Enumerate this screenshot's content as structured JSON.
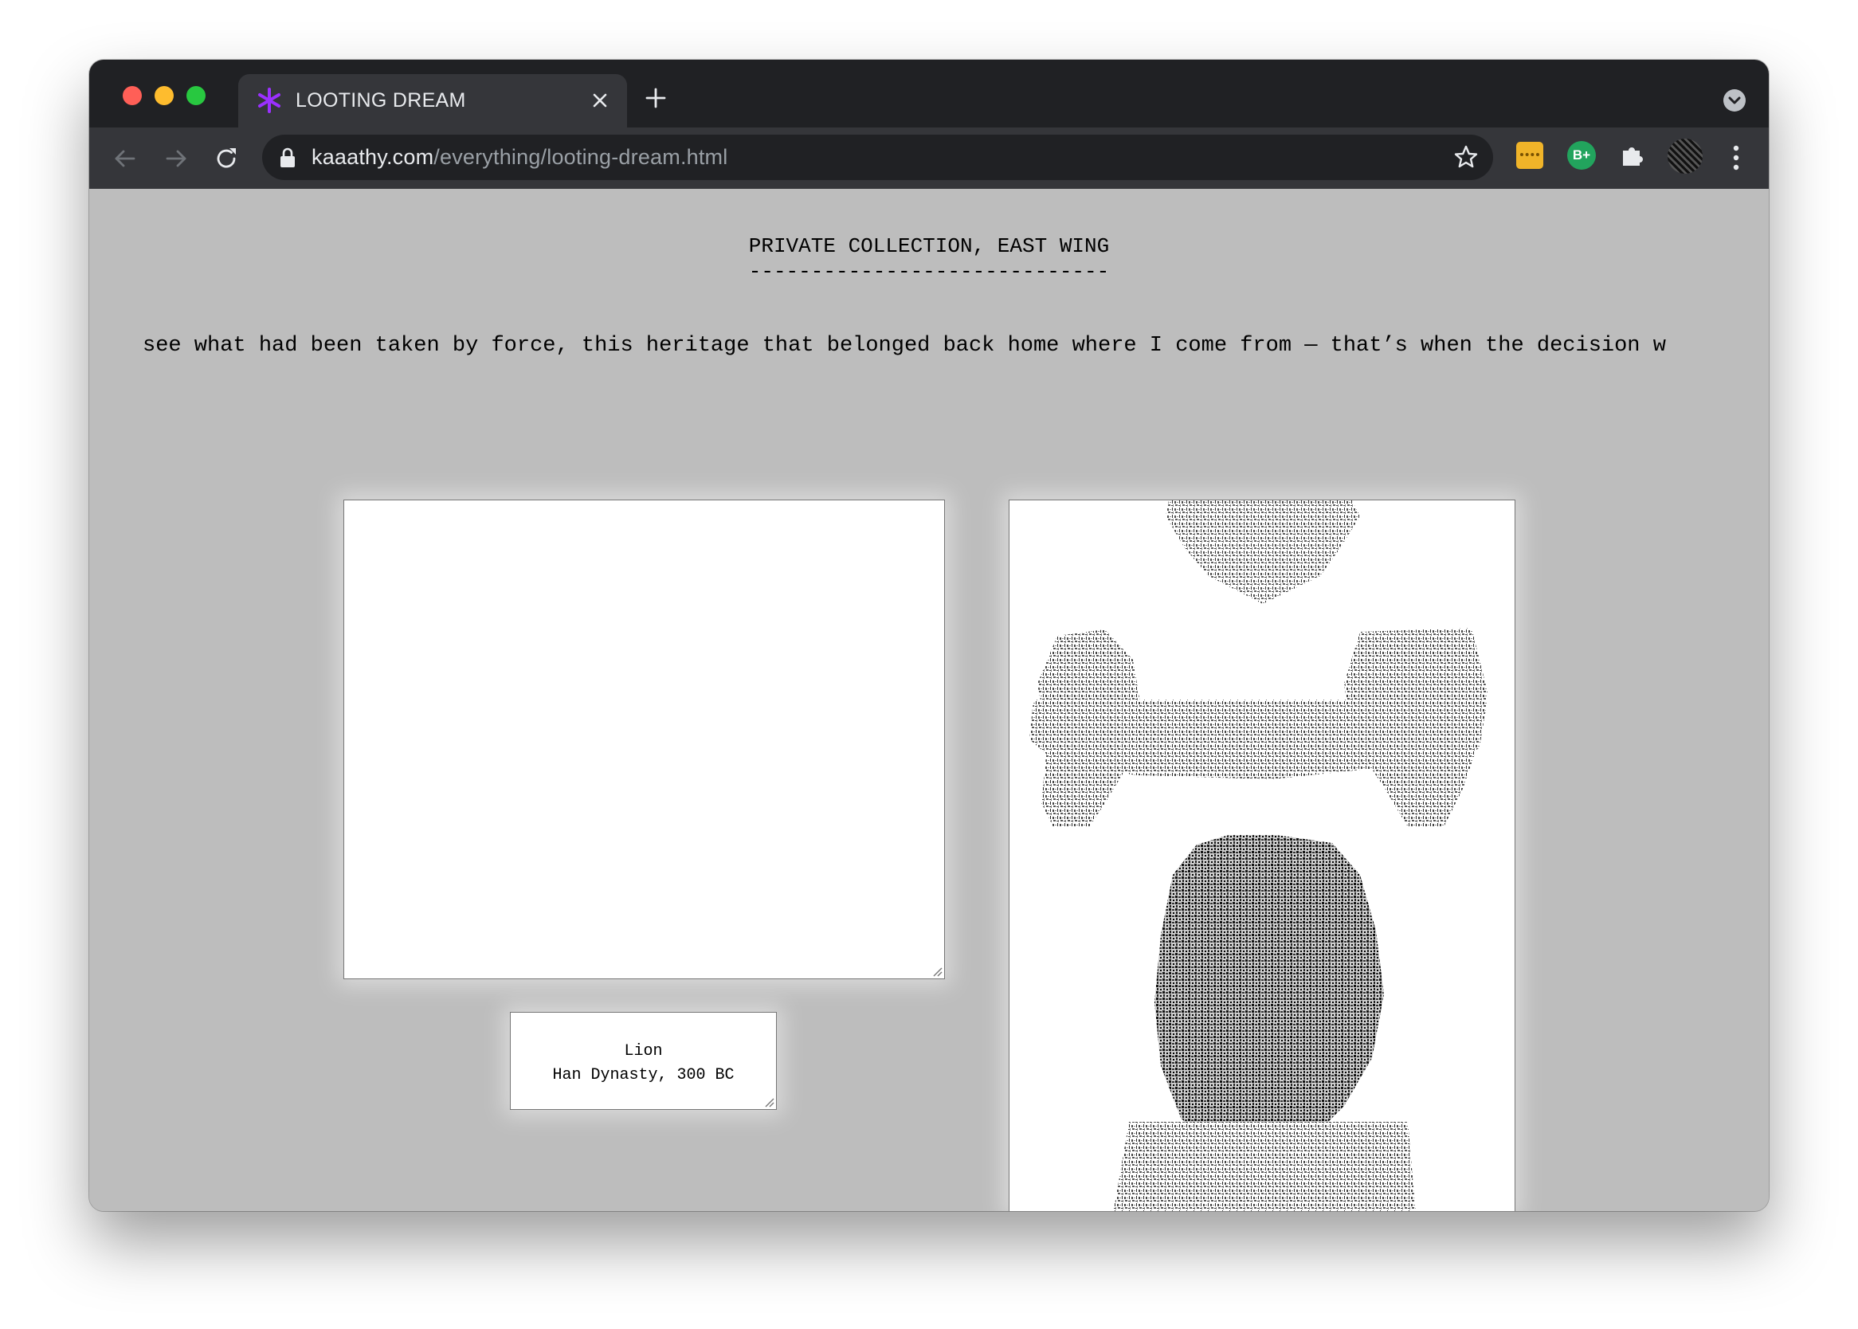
{
  "browser": {
    "tab_title": "LOOTING DREAM",
    "url_host": "kaaathy.com",
    "url_path": "/everything/looting-dream.html",
    "extension_badge": "B+",
    "colors": {
      "titlebar": "#202124",
      "toolbar": "#35363a",
      "favicon": "#9b30ff",
      "page_background": "#bdbdbd"
    }
  },
  "page": {
    "heading": "PRIVATE COLLECTION, EAST WING",
    "heading_underline": "-----------------------------",
    "scrolling_text": "see what had been taken by force, this heritage that belonged back home where I come from — that’s when the decision w",
    "textarea_value": "",
    "caption": {
      "line1": "Lion",
      "line2": "Han Dynasty, 300 BC"
    },
    "ascii_art_subject": "lion sculpture rendered as ASCII text"
  }
}
